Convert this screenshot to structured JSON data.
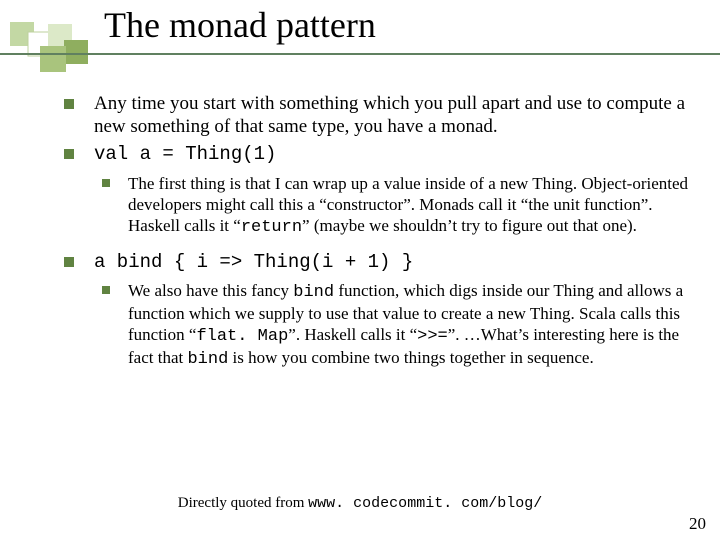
{
  "title": "The monad pattern",
  "items": [
    {
      "text": "Any time you start with something which you pull apart and use to compute a new something of that same type, you have a monad."
    },
    {
      "code": "val a = Thing(1)",
      "sub": {
        "prefix": "The first thing is that I can wrap up a value inside of a new Thing. Object-oriented developers might call this a “constructor”. Monads call it “the unit function”. Haskell calls it “",
        "code": "return",
        "suffix": "” (maybe we shouldn’t try to figure out that one)."
      }
    },
    {
      "code": "a bind { i => Thing(i + 1) }",
      "sub": {
        "prefix": "We also have this fancy ",
        "c1": "bind",
        "mid1": " function, which digs inside our Thing and allows a function which we supply to use that value to create a new Thing. Scala calls this function “",
        "c2": "flat. Map",
        "mid2": "”. Haskell calls it “",
        "c3": ">>=",
        "mid3": "”. …What’s interesting here is the fact that ",
        "c4": "bind",
        "suffix": " is how you combine two things together in sequence."
      }
    }
  ],
  "footer": {
    "prefix": "Directly quoted from ",
    "url": "www. codecommit. com/blog/"
  },
  "page_number": "20"
}
